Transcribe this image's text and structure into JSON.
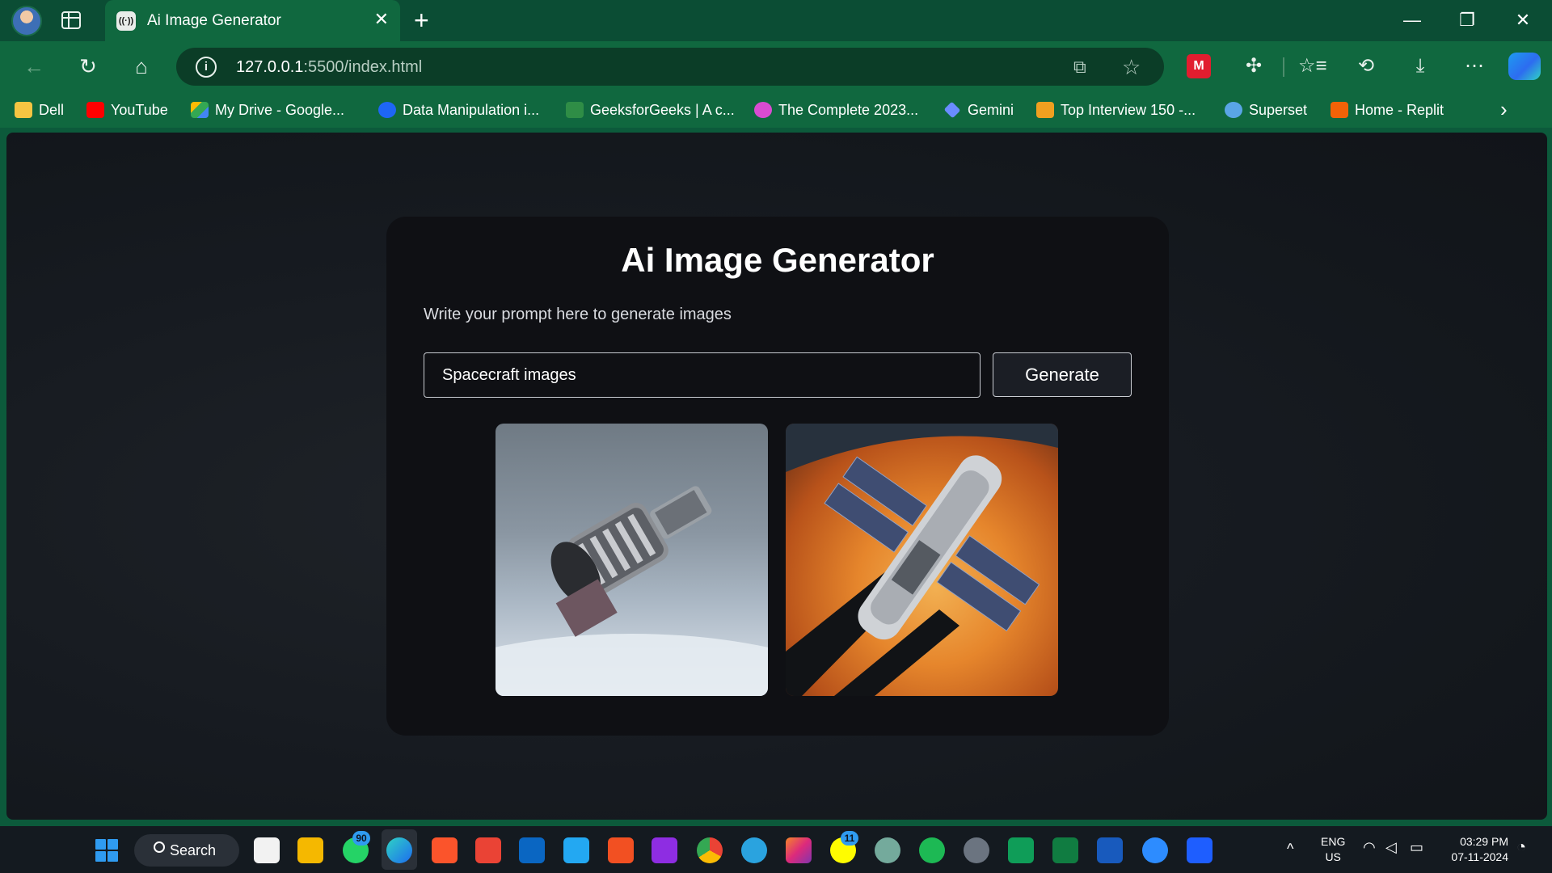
{
  "browser": {
    "tab": {
      "favicon": "((·))",
      "title": "Ai Image Generator",
      "close": "✕"
    },
    "new_tab": "+",
    "window_controls": {
      "minimize": "—",
      "restore": "❐",
      "close": "✕"
    },
    "toolbar": {
      "back": "←",
      "reload": "↻",
      "home": "⌂",
      "url_host": "127.0.0.1",
      "url_rest": ":5500/index.html",
      "info_icon": "i",
      "open_app_icon": "⧉",
      "favorite_icon": "☆",
      "extension_label": "M",
      "puzzle": "✣",
      "favorites": "☆≡",
      "history": "⟲",
      "download": "⤓",
      "more": "⋯"
    },
    "bookmarks": [
      {
        "label": "Dell",
        "icon": "folder-icon",
        "color": "#f5c542"
      },
      {
        "label": "YouTube",
        "icon": "youtube-icon",
        "color": "#ff0000"
      },
      {
        "label": "My Drive - Google...",
        "icon": "google-drive-icon",
        "color": "#34a853"
      },
      {
        "label": "Data Manipulation i...",
        "icon": "codechef-icon",
        "color": "#1e66f5"
      },
      {
        "label": "GeeksforGeeks | A c...",
        "icon": "geeksforgeeks-icon",
        "color": "#2f8d46"
      },
      {
        "label": "The Complete 2023...",
        "icon": "udemy-icon",
        "color": "#d94bd1"
      },
      {
        "label": "Gemini",
        "icon": "gemini-icon",
        "color": "#6a8cff"
      },
      {
        "label": "Top Interview 150 -...",
        "icon": "leetcode-icon",
        "color": "#f0a020"
      },
      {
        "label": "Superset",
        "icon": "superset-icon",
        "color": "#5aa5e6"
      },
      {
        "label": "Home - Replit",
        "icon": "replit-icon",
        "color": "#f26207"
      }
    ],
    "bookmarks_more": "›"
  },
  "app": {
    "title": "Ai Image Generator",
    "subtitle": "Write your prompt here to generate images",
    "prompt_value": "Spacecraft images",
    "generate_label": "Generate",
    "results": [
      {
        "name": "spacecraft-image-1"
      },
      {
        "name": "spacecraft-image-2"
      }
    ]
  },
  "taskbar": {
    "search_label": "Search",
    "whatsapp_badge": "90",
    "snapchat_badge": "11",
    "tray_chevron": "^",
    "lang_line1": "ENG",
    "lang_line2": "US",
    "time": "03:29 PM",
    "date": "07-11-2024"
  }
}
